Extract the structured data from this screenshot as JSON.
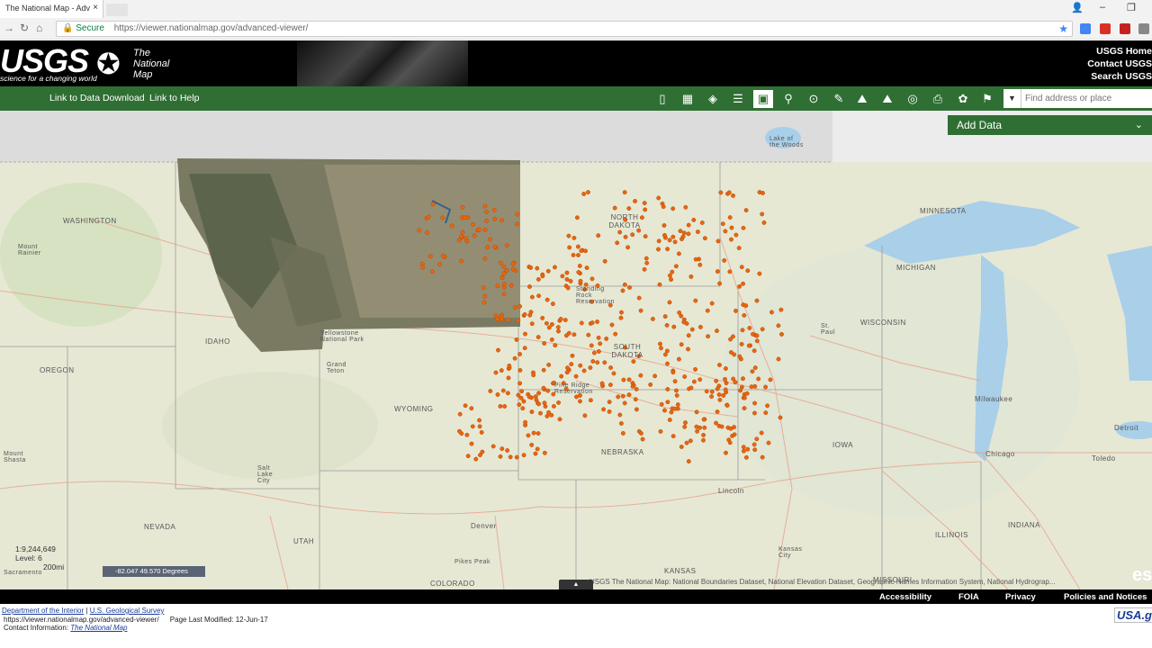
{
  "browser": {
    "tab_title": "The National Map - Adv",
    "tab_close": "×",
    "secure_label": "Secure",
    "url": "https://viewer.nationalmap.gov/advanced-viewer/"
  },
  "header": {
    "logo": "USGS",
    "tagline": "science for a changing world",
    "tnm_line1": "The",
    "tnm_line2": "National",
    "tnm_line3": "Map",
    "links": [
      "USGS Home",
      "Contact USGS",
      "Search USGS"
    ]
  },
  "toolbar": {
    "link_download": "Link to Data Download",
    "link_help": "Link to Help",
    "search_placeholder": "Find address or place",
    "icons": [
      "info-icon",
      "basemap-grid-icon",
      "layers-icon",
      "legend-list-icon",
      "add-data-icon",
      "share-icon",
      "identify-icon",
      "measure-icon",
      "elevation-profile-icon",
      "elevation-icon",
      "draw-circle-icon",
      "print-icon",
      "theme-icon",
      "bookmark-icon"
    ]
  },
  "add_data_panel": {
    "title": "Add Data",
    "chevron": "⌄"
  },
  "map": {
    "labels": [
      {
        "text": "WASHINGTON"
      },
      {
        "text": "OREGON"
      },
      {
        "text": "IDAHO"
      },
      {
        "text": "NEVADA"
      },
      {
        "text": "UTAH"
      },
      {
        "text": "WYOMING"
      },
      {
        "text": "COLORADO"
      },
      {
        "text": "NORTH DAKOTA"
      },
      {
        "text": "SOUTH DAKOTA"
      },
      {
        "text": "NEBRASKA"
      },
      {
        "text": "KANSAS"
      },
      {
        "text": "MINNESOTA"
      },
      {
        "text": "IOWA"
      },
      {
        "text": "MISSOURI"
      },
      {
        "text": "WISCONSIN"
      },
      {
        "text": "ILLINOIS"
      },
      {
        "text": "MICHIGAN"
      },
      {
        "text": "INDIANA"
      },
      {
        "text": "Chicago"
      },
      {
        "text": "Milwaukee"
      },
      {
        "text": "Denver"
      },
      {
        "text": "Salt Lake City"
      },
      {
        "text": "Lake of the Woods"
      },
      {
        "text": "Lincoln"
      },
      {
        "text": "Detroit"
      },
      {
        "text": "Toledo"
      },
      {
        "text": "Kansas City"
      },
      {
        "text": "Sacramento"
      },
      {
        "text": "Mount Rainier"
      },
      {
        "text": "Yellowstone National Park"
      },
      {
        "text": "Grand Teton"
      },
      {
        "text": "Pine Ridge Reservation"
      },
      {
        "text": "Standing Rock Reservation"
      },
      {
        "text": "Pikes Peak"
      },
      {
        "text": "Mount Shasta"
      },
      {
        "text": "St. Paul"
      }
    ],
    "scale": "1:9,244,649",
    "level": "Level: 6",
    "scale_bar": "200mi",
    "coordinates": "-82.047 49.570 Degrees",
    "attribution": "USGS The National Map: National Boundaries Dataset, National Elevation Dataset, Geographic Names Information System, National Hydrograp...",
    "esri": "es",
    "collapse_handle": "▲"
  },
  "footer": {
    "links": [
      "Accessibility",
      "FOIA",
      "Privacy",
      "Policies and Notices"
    ],
    "doi": "Department of the Interior",
    "sep": " | ",
    "usgs": "U.S. Geological Survey",
    "url_line": "https://viewer.nationalmap.gov/advanced-viewer/",
    "modified": "Page Last Modified: 12-Jun-17",
    "contact_label": "Contact Information:",
    "contact_link": "The National Map",
    "usagov": "USA.gov"
  },
  "colors": {
    "header_green": "#2f6f33",
    "dot_orange": "#e8660f"
  }
}
